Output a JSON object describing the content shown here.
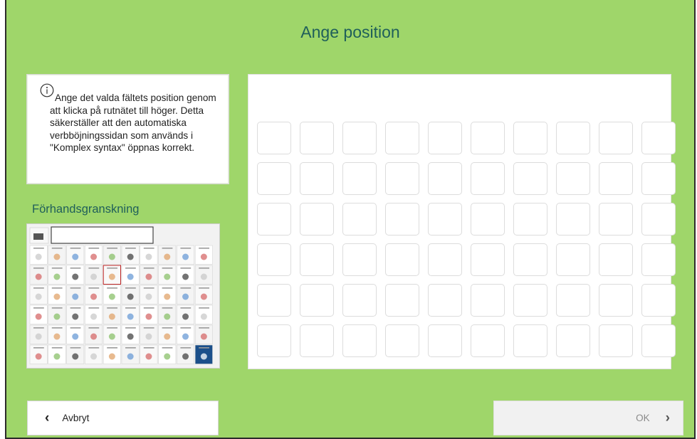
{
  "title": "Ange position",
  "info": {
    "icon": "info-icon",
    "text": "Ange det valda fältets position genom att klicka på rutnätet till höger. Detta säkerställer att den automatiska verbböjningssidan som används i  \"Komplex syntax\"  öppnas korrekt."
  },
  "preview": {
    "label": "Förhandsgranskning"
  },
  "grid": {
    "rows": 6,
    "cols": 10
  },
  "buttons": {
    "cancel_label": "Avbryt",
    "ok_label": "OK"
  },
  "colors": {
    "background": "#9fd66a",
    "accent_text": "#1f5f5a"
  }
}
